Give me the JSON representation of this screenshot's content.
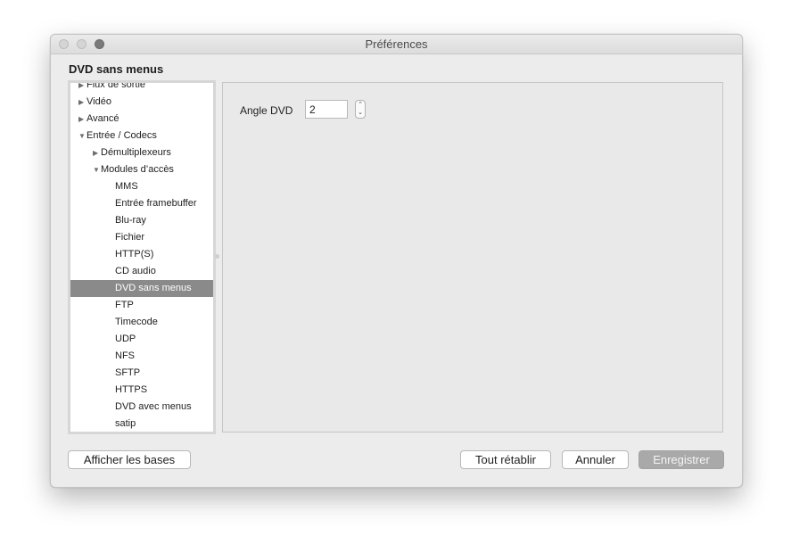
{
  "window": {
    "title": "Préférences"
  },
  "section_title": "DVD sans menus",
  "tree": {
    "items": [
      {
        "label": "Flux de sortie",
        "arrow": "▶",
        "level": 0
      },
      {
        "label": "Vidéo",
        "arrow": "▶",
        "level": 0
      },
      {
        "label": "Avancé",
        "arrow": "▶",
        "level": 0
      },
      {
        "label": "Entrée / Codecs",
        "arrow": "▼",
        "level": 0
      },
      {
        "label": "Démultiplexeurs",
        "arrow": "▶",
        "level": 1
      },
      {
        "label": "Modules d’accès",
        "arrow": "▼",
        "level": 1
      },
      {
        "label": "MMS",
        "level": 2
      },
      {
        "label": "Entrée framebuffer",
        "level": 2
      },
      {
        "label": "Blu-ray",
        "level": 2
      },
      {
        "label": "Fichier",
        "level": 2
      },
      {
        "label": "HTTP(S)",
        "level": 2
      },
      {
        "label": "CD audio",
        "level": 2
      },
      {
        "label": "DVD sans menus",
        "level": 2,
        "selected": true
      },
      {
        "label": "FTP",
        "level": 2
      },
      {
        "label": "Timecode",
        "level": 2
      },
      {
        "label": "UDP",
        "level": 2
      },
      {
        "label": "NFS",
        "level": 2
      },
      {
        "label": "SFTP",
        "level": 2
      },
      {
        "label": "HTTPS",
        "level": 2
      },
      {
        "label": "DVD avec menus",
        "level": 2
      },
      {
        "label": "satip",
        "level": 2
      }
    ]
  },
  "panel": {
    "angle_label": "Angle DVD",
    "angle_value": "2",
    "stepper_icons": {
      "up": "⌃",
      "down": "⌄"
    }
  },
  "buttons": {
    "show_basic": "Afficher les bases",
    "reset_all": "Tout rétablir",
    "cancel": "Annuler",
    "save": "Enregistrer"
  },
  "colors": {
    "selected_row": "#8a8a8a",
    "save_button_disabled": "#a9a9a9"
  }
}
